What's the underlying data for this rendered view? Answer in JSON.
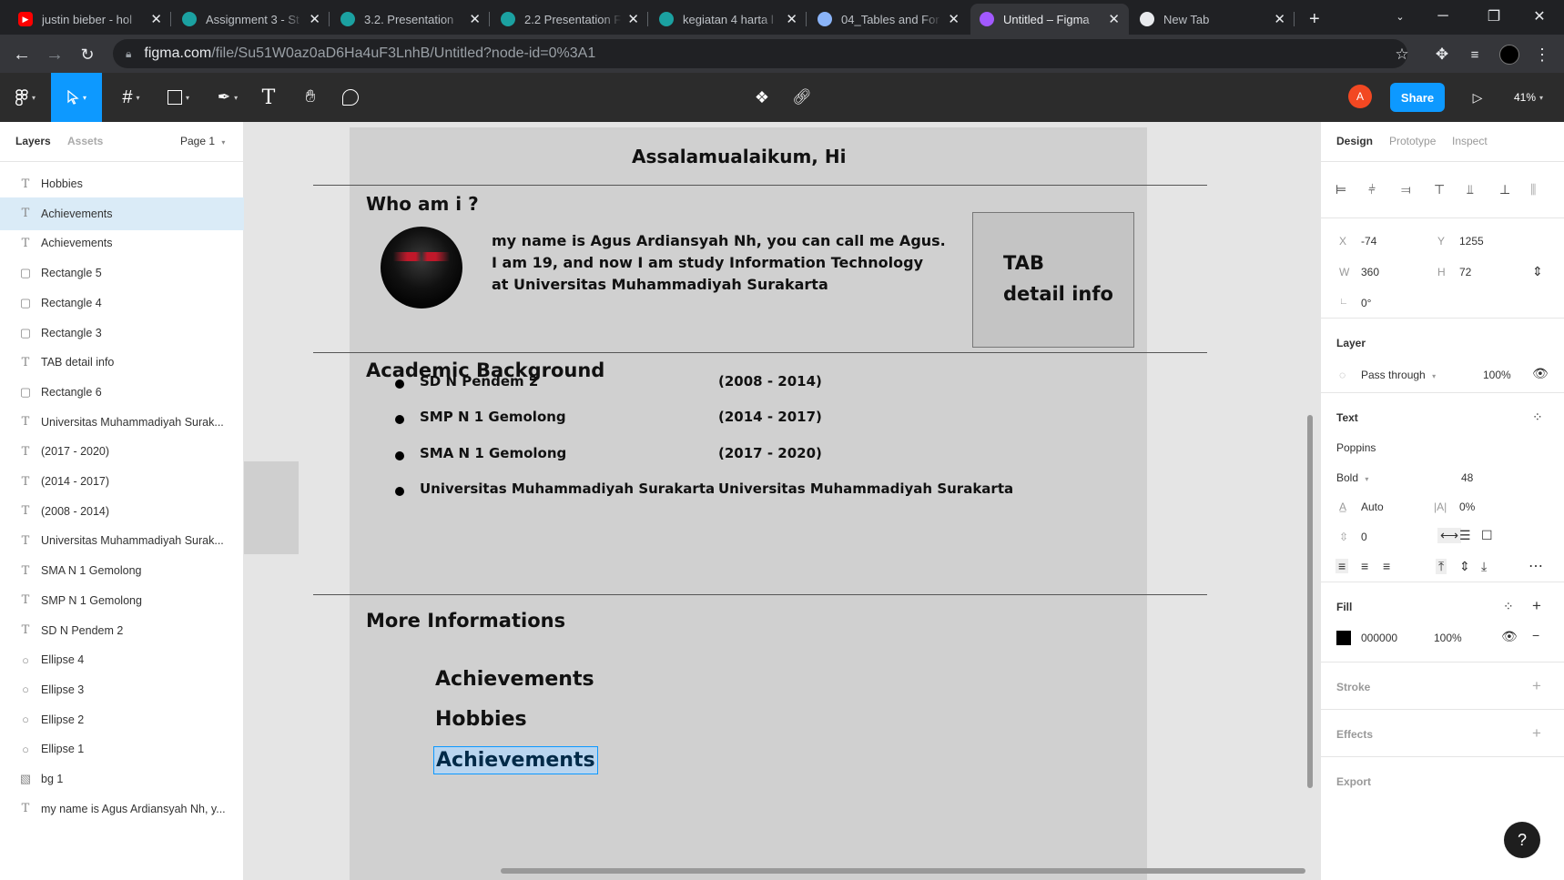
{
  "browser": {
    "tabs": [
      {
        "title": "justin bieber - hol",
        "favicon": "youtube",
        "color": "#ff0000"
      },
      {
        "title": "Assignment 3 - St",
        "favicon": "course",
        "color": "#1ba1a1"
      },
      {
        "title": "3.2. Presentation",
        "favicon": "course",
        "color": "#1ba1a1"
      },
      {
        "title": "2.2 Presentation F",
        "favicon": "course",
        "color": "#1ba1a1"
      },
      {
        "title": "kegiatan 4 harta l",
        "favicon": "course",
        "color": "#1ba1a1"
      },
      {
        "title": "04_Tables and For",
        "favicon": "globe",
        "color": "#8ab4f8"
      },
      {
        "title": "Untitled – Figma",
        "favicon": "figma",
        "color": "#a259ff"
      },
      {
        "title": "New Tab",
        "favicon": "chrome",
        "color": "#e8eaed"
      }
    ],
    "url_host": "figma.com",
    "url_path": "/file/Su51W0az0aD6Ha4uF3LnhB/Untitled?node-id=0%3A1"
  },
  "toolbar": {
    "share_label": "Share",
    "zoom": "41%",
    "avatar_initial": "A"
  },
  "left_panel": {
    "tab_layers": "Layers",
    "tab_assets": "Assets",
    "page": "Page 1",
    "layers": [
      {
        "type": "text",
        "name": "Hobbies"
      },
      {
        "type": "text",
        "name": "Achievements",
        "selected": true
      },
      {
        "type": "text",
        "name": "Achievements"
      },
      {
        "type": "rect",
        "name": "Rectangle 5"
      },
      {
        "type": "rect",
        "name": "Rectangle 4"
      },
      {
        "type": "rect",
        "name": "Rectangle 3"
      },
      {
        "type": "text",
        "name": "TAB detail info"
      },
      {
        "type": "rect",
        "name": "Rectangle 6"
      },
      {
        "type": "text",
        "name": "Universitas Muhammadiyah Surak..."
      },
      {
        "type": "text",
        "name": "(2017 - 2020)"
      },
      {
        "type": "text",
        "name": "(2014 - 2017)"
      },
      {
        "type": "text",
        "name": "(2008 - 2014)"
      },
      {
        "type": "text",
        "name": "Universitas Muhammadiyah Surak..."
      },
      {
        "type": "text",
        "name": "SMA N 1 Gemolong"
      },
      {
        "type": "text",
        "name": "SMP N 1 Gemolong"
      },
      {
        "type": "text",
        "name": "SD N Pendem 2"
      },
      {
        "type": "ellipse",
        "name": "Ellipse 4"
      },
      {
        "type": "ellipse",
        "name": "Ellipse 3"
      },
      {
        "type": "ellipse",
        "name": "Ellipse 2"
      },
      {
        "type": "ellipse",
        "name": "Ellipse 1"
      },
      {
        "type": "image",
        "name": "bg 1"
      },
      {
        "type": "text",
        "name": "my name is Agus Ardiansyah Nh, y..."
      }
    ]
  },
  "canvas": {
    "greeting": "Assalamualaikum, Hi",
    "who_title": "Who am i ?",
    "intro_lines": [
      "my name is Agus Ardiansyah Nh, you can call me Agus.",
      "I am 19, and now I am study Information Technology",
      "at Universitas Muhammadiyah Surakarta"
    ],
    "tab_box": [
      "TAB",
      "detail info"
    ],
    "academic_title": "Academic Background",
    "schools": [
      {
        "name": "SD N Pendem 2",
        "years": "(2008 - 2014)"
      },
      {
        "name": "SMP N 1 Gemolong",
        "years": "(2014 - 2017)"
      },
      {
        "name": "SMA N 1 Gemolong",
        "years": "(2017 - 2020)"
      },
      {
        "name": "Universitas Muhammadiyah Surakarta",
        "years": "Universitas Muhammadiyah Surakarta"
      }
    ],
    "more_title": "More Informations",
    "more_items": [
      "Achievements",
      "Hobbies",
      "Achievements"
    ]
  },
  "right_panel": {
    "tabs": [
      "Design",
      "Prototype",
      "Inspect"
    ],
    "x": "-74",
    "y": "1255",
    "w": "360",
    "h": "72",
    "rotation": "0°",
    "layer_title": "Layer",
    "blend": "Pass through",
    "opacity": "100%",
    "text_title": "Text",
    "font": "Poppins",
    "weight": "Bold",
    "size": "48",
    "line_height": "Auto",
    "letter_spacing": "0%",
    "paragraph_spacing": "0",
    "fill_title": "Fill",
    "fill_hex": "000000",
    "fill_opacity": "100%",
    "fill_color": "#000000",
    "stroke_title": "Stroke",
    "effects_title": "Effects",
    "export_title": "Export"
  }
}
